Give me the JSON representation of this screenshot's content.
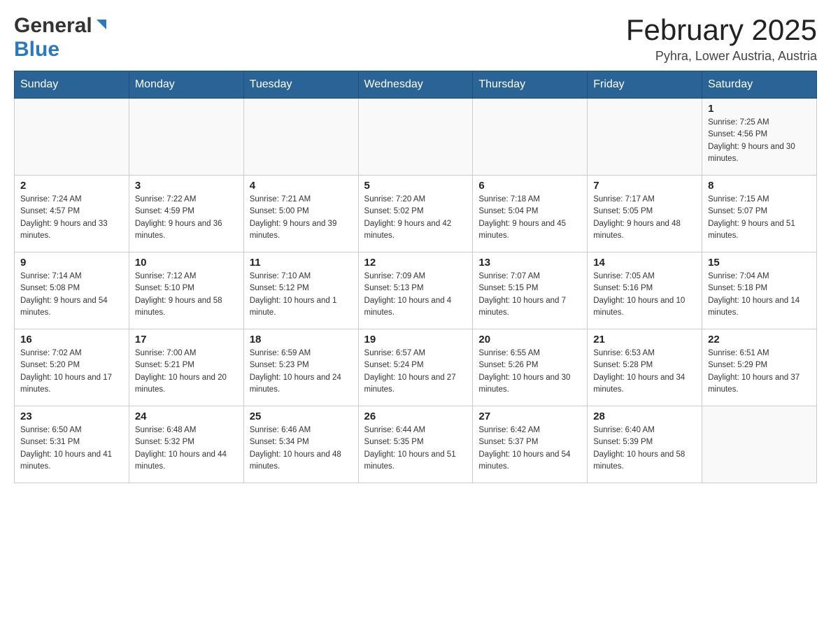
{
  "header": {
    "logo_general": "General",
    "logo_blue": "Blue",
    "month_title": "February 2025",
    "location": "Pyhra, Lower Austria, Austria"
  },
  "weekdays": [
    "Sunday",
    "Monday",
    "Tuesday",
    "Wednesday",
    "Thursday",
    "Friday",
    "Saturday"
  ],
  "weeks": [
    [
      {
        "day": "",
        "info": ""
      },
      {
        "day": "",
        "info": ""
      },
      {
        "day": "",
        "info": ""
      },
      {
        "day": "",
        "info": ""
      },
      {
        "day": "",
        "info": ""
      },
      {
        "day": "",
        "info": ""
      },
      {
        "day": "1",
        "info": "Sunrise: 7:25 AM\nSunset: 4:56 PM\nDaylight: 9 hours and 30 minutes."
      }
    ],
    [
      {
        "day": "2",
        "info": "Sunrise: 7:24 AM\nSunset: 4:57 PM\nDaylight: 9 hours and 33 minutes."
      },
      {
        "day": "3",
        "info": "Sunrise: 7:22 AM\nSunset: 4:59 PM\nDaylight: 9 hours and 36 minutes."
      },
      {
        "day": "4",
        "info": "Sunrise: 7:21 AM\nSunset: 5:00 PM\nDaylight: 9 hours and 39 minutes."
      },
      {
        "day": "5",
        "info": "Sunrise: 7:20 AM\nSunset: 5:02 PM\nDaylight: 9 hours and 42 minutes."
      },
      {
        "day": "6",
        "info": "Sunrise: 7:18 AM\nSunset: 5:04 PM\nDaylight: 9 hours and 45 minutes."
      },
      {
        "day": "7",
        "info": "Sunrise: 7:17 AM\nSunset: 5:05 PM\nDaylight: 9 hours and 48 minutes."
      },
      {
        "day": "8",
        "info": "Sunrise: 7:15 AM\nSunset: 5:07 PM\nDaylight: 9 hours and 51 minutes."
      }
    ],
    [
      {
        "day": "9",
        "info": "Sunrise: 7:14 AM\nSunset: 5:08 PM\nDaylight: 9 hours and 54 minutes."
      },
      {
        "day": "10",
        "info": "Sunrise: 7:12 AM\nSunset: 5:10 PM\nDaylight: 9 hours and 58 minutes."
      },
      {
        "day": "11",
        "info": "Sunrise: 7:10 AM\nSunset: 5:12 PM\nDaylight: 10 hours and 1 minute."
      },
      {
        "day": "12",
        "info": "Sunrise: 7:09 AM\nSunset: 5:13 PM\nDaylight: 10 hours and 4 minutes."
      },
      {
        "day": "13",
        "info": "Sunrise: 7:07 AM\nSunset: 5:15 PM\nDaylight: 10 hours and 7 minutes."
      },
      {
        "day": "14",
        "info": "Sunrise: 7:05 AM\nSunset: 5:16 PM\nDaylight: 10 hours and 10 minutes."
      },
      {
        "day": "15",
        "info": "Sunrise: 7:04 AM\nSunset: 5:18 PM\nDaylight: 10 hours and 14 minutes."
      }
    ],
    [
      {
        "day": "16",
        "info": "Sunrise: 7:02 AM\nSunset: 5:20 PM\nDaylight: 10 hours and 17 minutes."
      },
      {
        "day": "17",
        "info": "Sunrise: 7:00 AM\nSunset: 5:21 PM\nDaylight: 10 hours and 20 minutes."
      },
      {
        "day": "18",
        "info": "Sunrise: 6:59 AM\nSunset: 5:23 PM\nDaylight: 10 hours and 24 minutes."
      },
      {
        "day": "19",
        "info": "Sunrise: 6:57 AM\nSunset: 5:24 PM\nDaylight: 10 hours and 27 minutes."
      },
      {
        "day": "20",
        "info": "Sunrise: 6:55 AM\nSunset: 5:26 PM\nDaylight: 10 hours and 30 minutes."
      },
      {
        "day": "21",
        "info": "Sunrise: 6:53 AM\nSunset: 5:28 PM\nDaylight: 10 hours and 34 minutes."
      },
      {
        "day": "22",
        "info": "Sunrise: 6:51 AM\nSunset: 5:29 PM\nDaylight: 10 hours and 37 minutes."
      }
    ],
    [
      {
        "day": "23",
        "info": "Sunrise: 6:50 AM\nSunset: 5:31 PM\nDaylight: 10 hours and 41 minutes."
      },
      {
        "day": "24",
        "info": "Sunrise: 6:48 AM\nSunset: 5:32 PM\nDaylight: 10 hours and 44 minutes."
      },
      {
        "day": "25",
        "info": "Sunrise: 6:46 AM\nSunset: 5:34 PM\nDaylight: 10 hours and 48 minutes."
      },
      {
        "day": "26",
        "info": "Sunrise: 6:44 AM\nSunset: 5:35 PM\nDaylight: 10 hours and 51 minutes."
      },
      {
        "day": "27",
        "info": "Sunrise: 6:42 AM\nSunset: 5:37 PM\nDaylight: 10 hours and 54 minutes."
      },
      {
        "day": "28",
        "info": "Sunrise: 6:40 AM\nSunset: 5:39 PM\nDaylight: 10 hours and 58 minutes."
      },
      {
        "day": "",
        "info": ""
      }
    ]
  ]
}
